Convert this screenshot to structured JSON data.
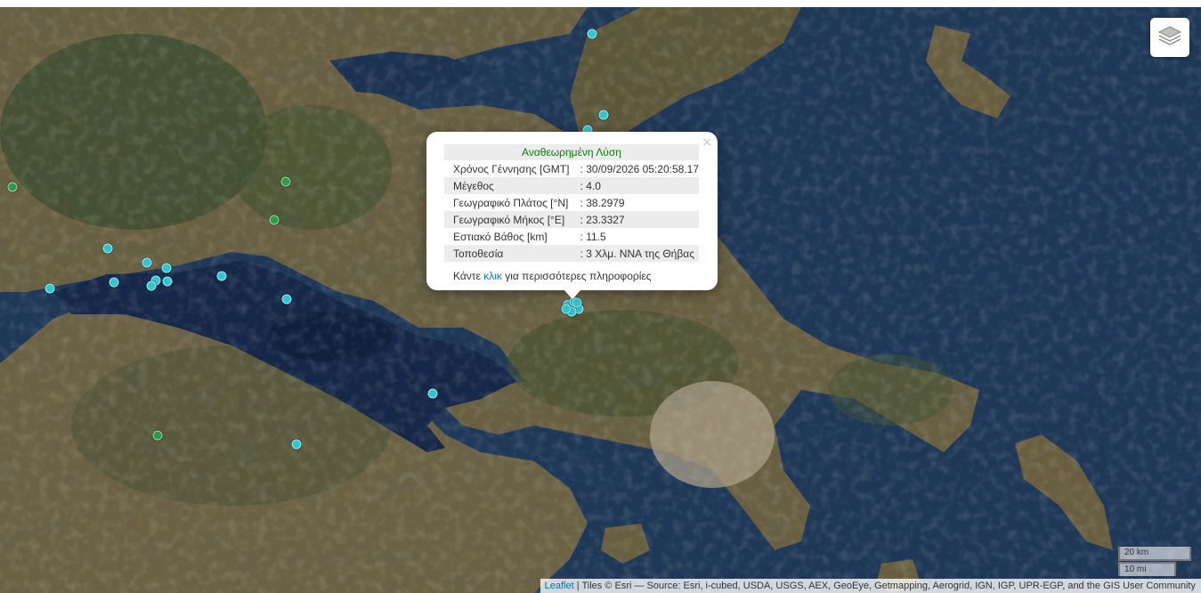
{
  "map": {
    "layers_icon": "layers-icon",
    "colors": {
      "sea": "#1e3654",
      "land": "#6b5e3c",
      "forest": "#3d4a2a",
      "urban": "#a89c86",
      "marker_recent": "#2fc6d4",
      "marker_old": "#2e9a4c"
    }
  },
  "popup": {
    "title": "Αναθεωρημένη Λύση",
    "close_symbol": "×",
    "rows": [
      {
        "label": "Χρόνος Γέννησης [GMT]",
        "value": ": 30/09/2026 05:20:58.17"
      },
      {
        "label": "Μέγεθος",
        "value": ": 4.0"
      },
      {
        "label": "Γεωγραφικό Πλάτος [°N]",
        "value": ": 38.2979"
      },
      {
        "label": "Γεωγραφικό Μήκος [°E]",
        "value": ": 23.3327"
      },
      {
        "label": "Εστιακό Βάθος [km]",
        "value": ": 11.5"
      },
      {
        "label": "Τοποθεσία",
        "value": ": 3 Χλμ. ΝΝΑ της Θήβας"
      }
    ],
    "footer_before": "Κάντε ",
    "footer_link": "κλικ",
    "footer_after": " για περισσότερες πληροφορίες"
  },
  "scale": {
    "km_label": "20 km",
    "mi_label": "10 mi"
  },
  "attribution": {
    "leaflet_label": "Leaflet",
    "text": " | Tiles © Esri — Source: Esri, i-cubed, USDA, USGS, AEX, GeoEye, Getmapping, Aerogrid, IGN, IGP, UPR-EGP, and the GIS User Community"
  }
}
